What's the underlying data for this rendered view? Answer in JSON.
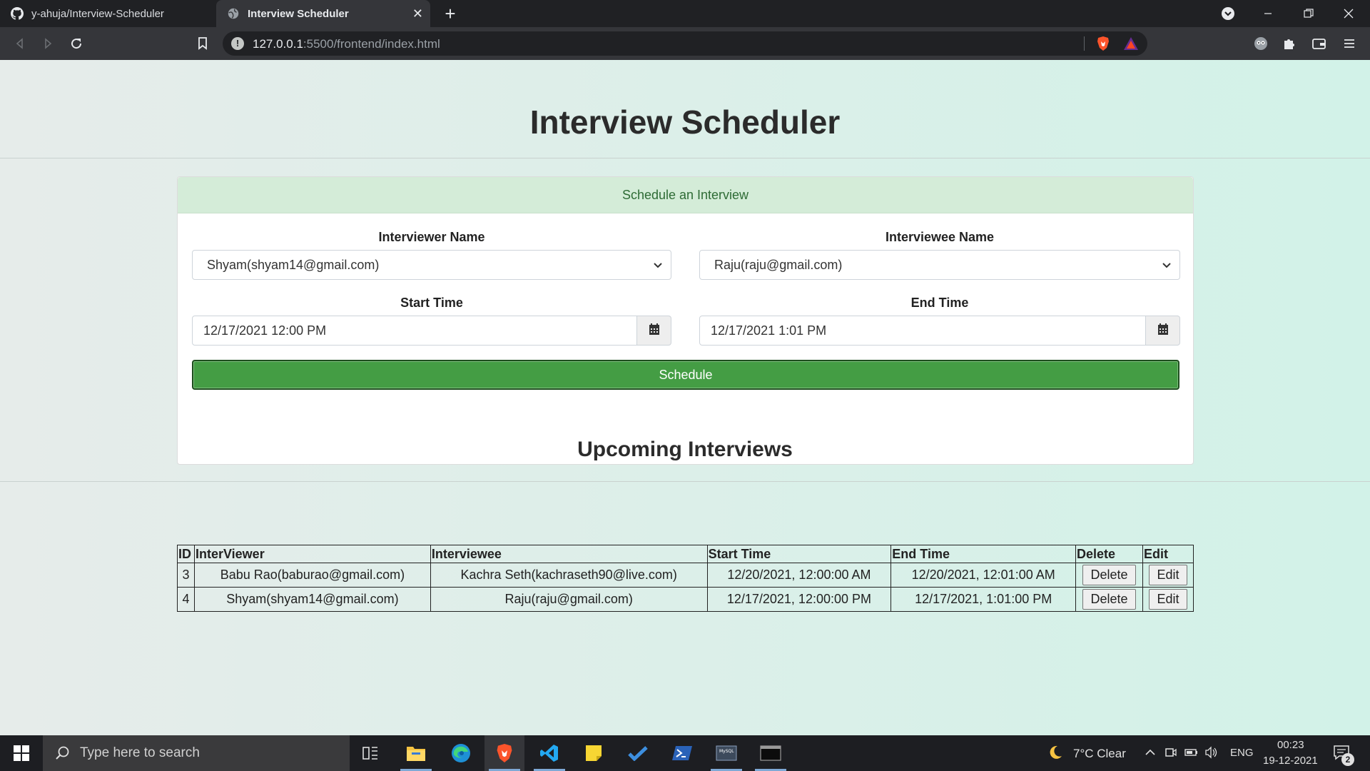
{
  "browser": {
    "tabs": [
      {
        "title": "y-ahuja/Interview-Scheduler",
        "icon": "github-icon"
      },
      {
        "title": "Interview Scheduler",
        "icon": "globe-icon"
      }
    ],
    "url_host": "127.0.0.1",
    "url_rest": ":5500/frontend/index.html"
  },
  "page": {
    "title": "Interview Scheduler",
    "form": {
      "header": "Schedule an Interview",
      "interviewer_label": "Interviewer Name",
      "interviewer_value": "Shyam(shyam14@gmail.com)",
      "interviewee_label": "Interviewee Name",
      "interviewee_value": "Raju(raju@gmail.com)",
      "start_label": "Start Time",
      "start_value": "12/17/2021 12:00 PM",
      "end_label": "End Time",
      "end_value": "12/17/2021 1:01 PM",
      "submit_label": "Schedule"
    },
    "upcoming_title": "Upcoming Interviews",
    "table": {
      "headers": [
        "ID",
        "InterViewer",
        "Interviewee",
        "Start Time",
        "End Time",
        "Delete",
        "Edit"
      ],
      "rows": [
        {
          "id": "3",
          "interviewer": "Babu Rao(baburao@gmail.com)",
          "interviewee": "Kachra Seth(kachraseth90@live.com)",
          "start": "12/20/2021, 12:00:00 AM",
          "end": "12/20/2021, 12:01:00 AM",
          "delete": "Delete",
          "edit": "Edit"
        },
        {
          "id": "4",
          "interviewer": "Shyam(shyam14@gmail.com)",
          "interviewee": "Raju(raju@gmail.com)",
          "start": "12/17/2021, 12:00:00 PM",
          "end": "12/17/2021, 1:01:00 PM",
          "delete": "Delete",
          "edit": "Edit"
        }
      ]
    }
  },
  "taskbar": {
    "search_placeholder": "Type here to search",
    "weather": "7°C  Clear",
    "language": "ENG",
    "time": "00:23",
    "date": "19-12-2021",
    "notifications": "2"
  },
  "colors": {
    "accent_green": "#449d44",
    "card_header_bg": "#d4ecd8",
    "card_header_text": "#2e6b35"
  }
}
